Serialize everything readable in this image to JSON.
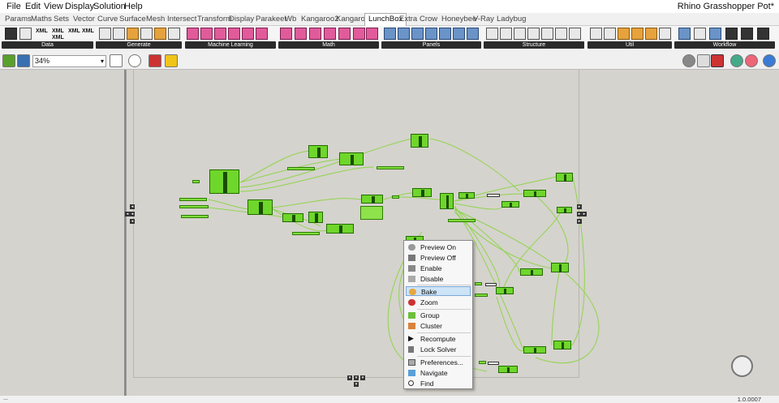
{
  "menubar": {
    "items": [
      "File",
      "Edit",
      "View",
      "Display",
      "Solution",
      "Help"
    ],
    "title": "Rhino Grasshopper Pot*"
  },
  "tabs": {
    "items": [
      "Params",
      "Maths",
      "Sets",
      "Vector",
      "Curve",
      "Surface",
      "Mesh",
      "Intersect",
      "Transform",
      "Display",
      "Parakeet",
      "Wb",
      "Kangaroo2",
      "Kangaroo",
      "LunchBox",
      "Extra",
      "Crow",
      "Honeybee",
      "V-Ray",
      "Ladybug"
    ],
    "active": "LunchBox"
  },
  "ribbon": {
    "groups": [
      "Data",
      "Generate",
      "Machine Learning",
      "Math",
      "Panels",
      "Structure",
      "Util",
      "Workflow"
    ],
    "xml_labels": [
      "XML",
      "XML",
      "XML",
      "XML",
      "XML"
    ]
  },
  "toolbar": {
    "zoom": "34%"
  },
  "context_menu": {
    "items": [
      "Preview On",
      "Preview Off",
      "Enable",
      "Disable",
      "Bake",
      "Zoom",
      "Group",
      "Cluster",
      "Recompute",
      "Lock Solver",
      "Preferences...",
      "Navigate",
      "Find"
    ],
    "highlighted": "Bake"
  },
  "status": {
    "version": "1.0.0007",
    "left_text": "..."
  },
  "colors": {
    "canvas": "#d5d3cd",
    "component": "#6fd62b",
    "wire": "#8fd44d",
    "highlight": "#cde4f7"
  }
}
